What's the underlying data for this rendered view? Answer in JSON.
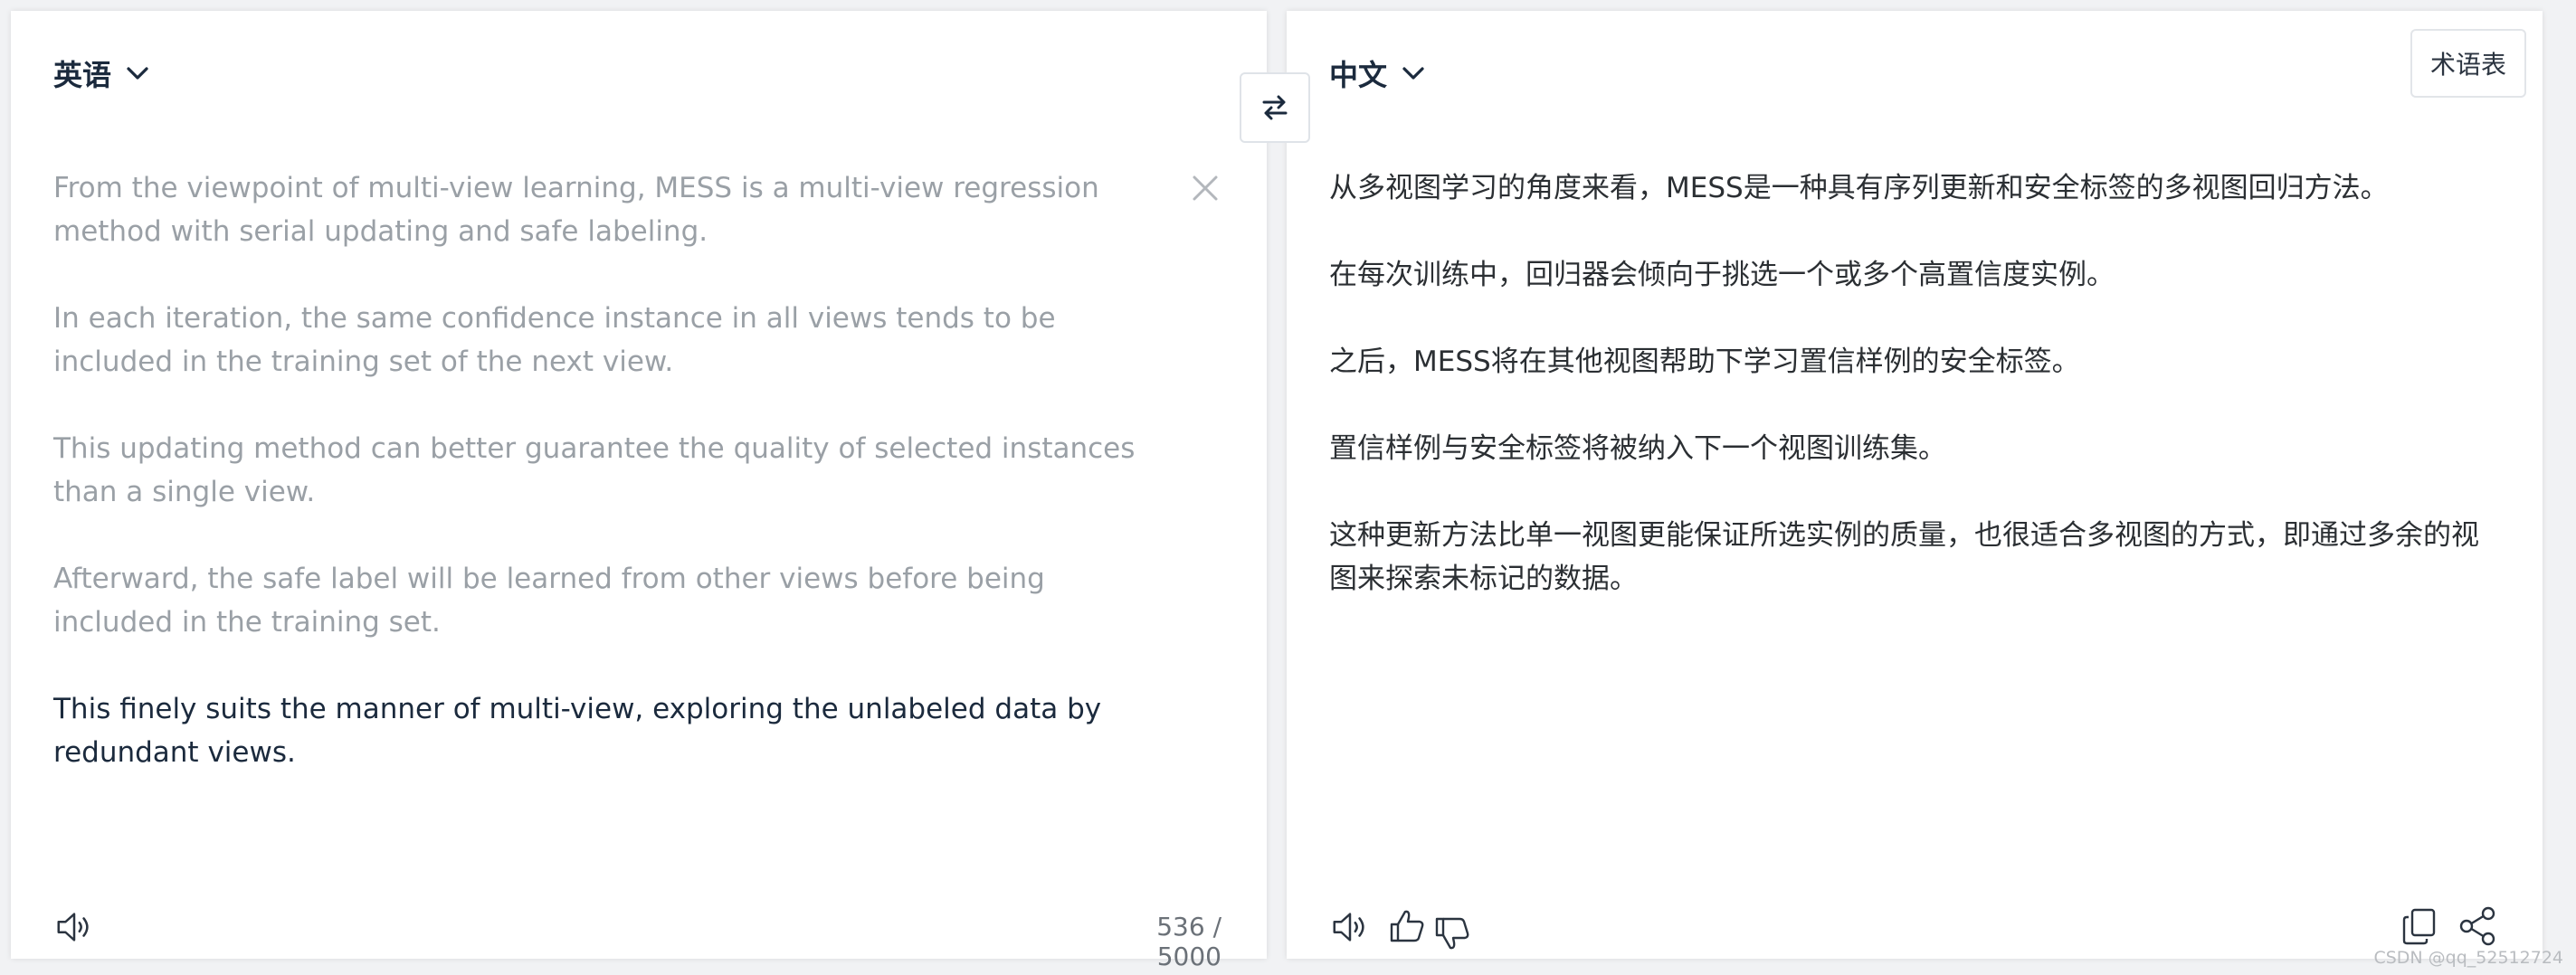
{
  "source_panel": {
    "language_label": "英语",
    "paragraphs": [
      "From the viewpoint of multi-view learning, MESS is a multi-view regression method with serial updating and safe labeling.",
      "In each iteration, the same confidence instance in all views tends to be included in the training set of the next view.",
      "This updating method can better guarantee the quality of selected instances than a single view.",
      "Afterward, the safe label will be learned from other views before being included in the training set.",
      "This finely suits the manner of multi-view, exploring the unlabeled data by redundant views."
    ],
    "char_count": "536 / 5000"
  },
  "target_panel": {
    "language_label": "中文",
    "glossary_label": "术语表",
    "paragraphs": [
      "从多视图学习的角度来看，MESS是一种具有序列更新和安全标签的多视图回归方法。",
      "在每次训练中，回归器会倾向于挑选一个或多个高置信度实例。",
      "之后，MESS将在其他视图帮助下学习置信样例的安全标签。",
      "置信样例与安全标签将被纳入下一个视图训练集。",
      "这种更新方法比单一视图更能保证所选实例的质量，也很适合多视图的方式，即通过多余的视图来探索未标记的数据。"
    ]
  },
  "watermark": "CSDN @qq_52512724",
  "icons": {
    "swap": "swap-arrows-icon",
    "clear": "close-icon",
    "speaker": "speaker-icon",
    "thumbs_up": "thumbs-up-icon",
    "thumbs_down": "thumbs-down-icon",
    "copy": "copy-icon",
    "share": "share-icon",
    "chevron": "chevron-down-icon"
  },
  "colors": {
    "background": "#f1f2f4",
    "panel": "#ffffff",
    "heading": "#1b2a3d",
    "muted_text": "#9aa0a6",
    "body_text": "#2b2f33"
  }
}
